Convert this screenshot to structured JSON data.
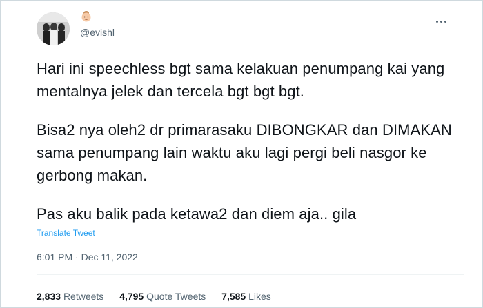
{
  "user": {
    "handle": "@evishl",
    "avatar_icon": "profile-photo-icon",
    "name_icon": "baby-face-emoji-icon"
  },
  "menu": {
    "more_icon": "more-horizontal-icon"
  },
  "tweet": {
    "paragraphs": [
      "Hari ini speechless bgt sama kelakuan penumpang kai yang mentalnya jelek dan tercela bgt bgt bgt.",
      "Bisa2 nya oleh2 dr primarasaku DIBONGKAR dan DIMAKAN sama penumpang lain waktu aku lagi pergi beli nasgor ke gerbong makan.",
      "Pas aku balik pada ketawa2 dan diem aja.. gila"
    ],
    "translate_label": "Translate Tweet",
    "timestamp": "6:01 PM · Dec 11, 2022"
  },
  "stats": {
    "retweets": {
      "count": "2,833",
      "label": "Retweets"
    },
    "quotes": {
      "count": "4,795",
      "label": "Quote Tweets"
    },
    "likes": {
      "count": "7,585",
      "label": "Likes"
    }
  },
  "colors": {
    "text": "#0f1419",
    "secondary": "#536471",
    "link": "#1d9bf0",
    "border": "#cfd9de"
  }
}
